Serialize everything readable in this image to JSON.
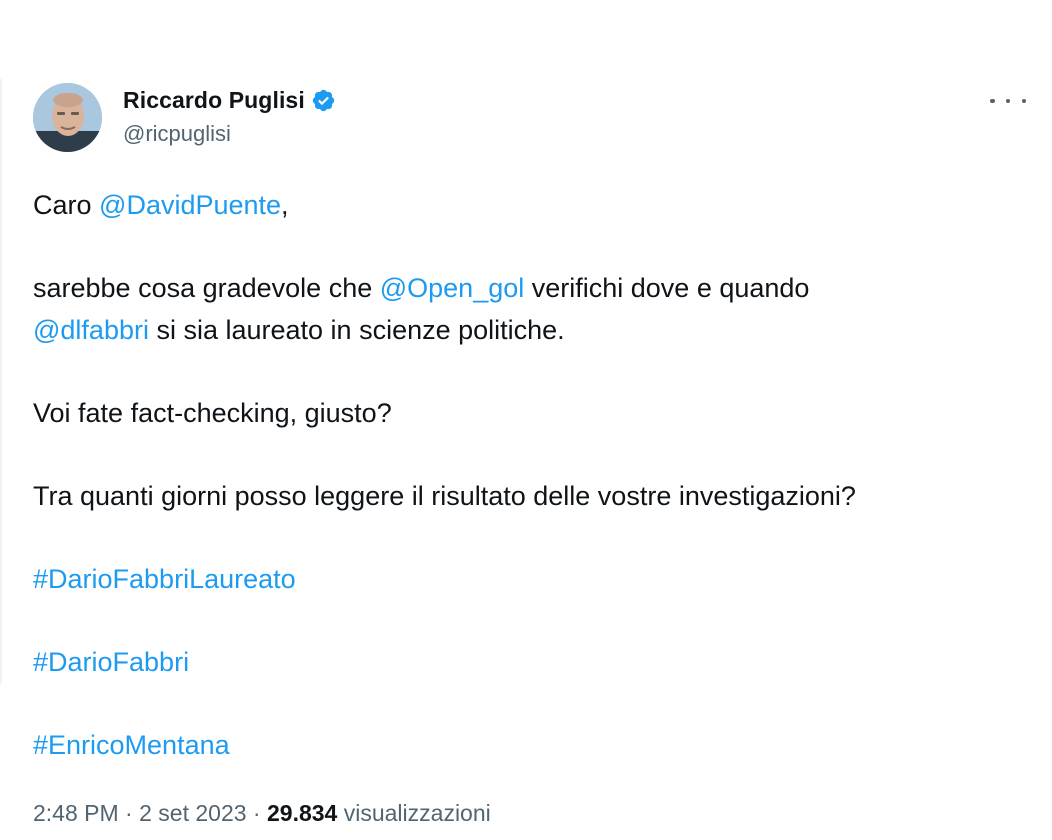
{
  "author": {
    "display_name": "Riccardo Puglisi",
    "handle": "@ricpuglisi",
    "verified": true
  },
  "tweet": {
    "line1_prefix": "Caro ",
    "line1_mention": "@DavidPuente",
    "line1_suffix": ",",
    "line2_prefix": "sarebbe cosa gradevole che ",
    "line2_mention": "@Open_gol",
    "line2_suffix": " verifichi dove e quando",
    "line3_mention": "@dlfabbri",
    "line3_suffix": " si sia laureato in scienze politiche.",
    "line4": "Voi fate fact-checking, giusto?",
    "line5": "Tra quanti giorni posso leggere il risultato delle vostre investigazioni?",
    "hashtags": [
      "#DarioFabbriLaureato",
      "#DarioFabbri",
      "#EnricoMentana"
    ]
  },
  "meta": {
    "time": "2:48 PM",
    "separator": " · ",
    "date": "2 set 2023",
    "views_count": "29.834",
    "views_label": " visualizzazioni"
  },
  "icons": {
    "verified": "verified-badge-icon",
    "more": "more-horizontal-icon"
  },
  "colors": {
    "link": "#1d9bf0",
    "text": "#0f1419",
    "secondary": "#536471"
  }
}
